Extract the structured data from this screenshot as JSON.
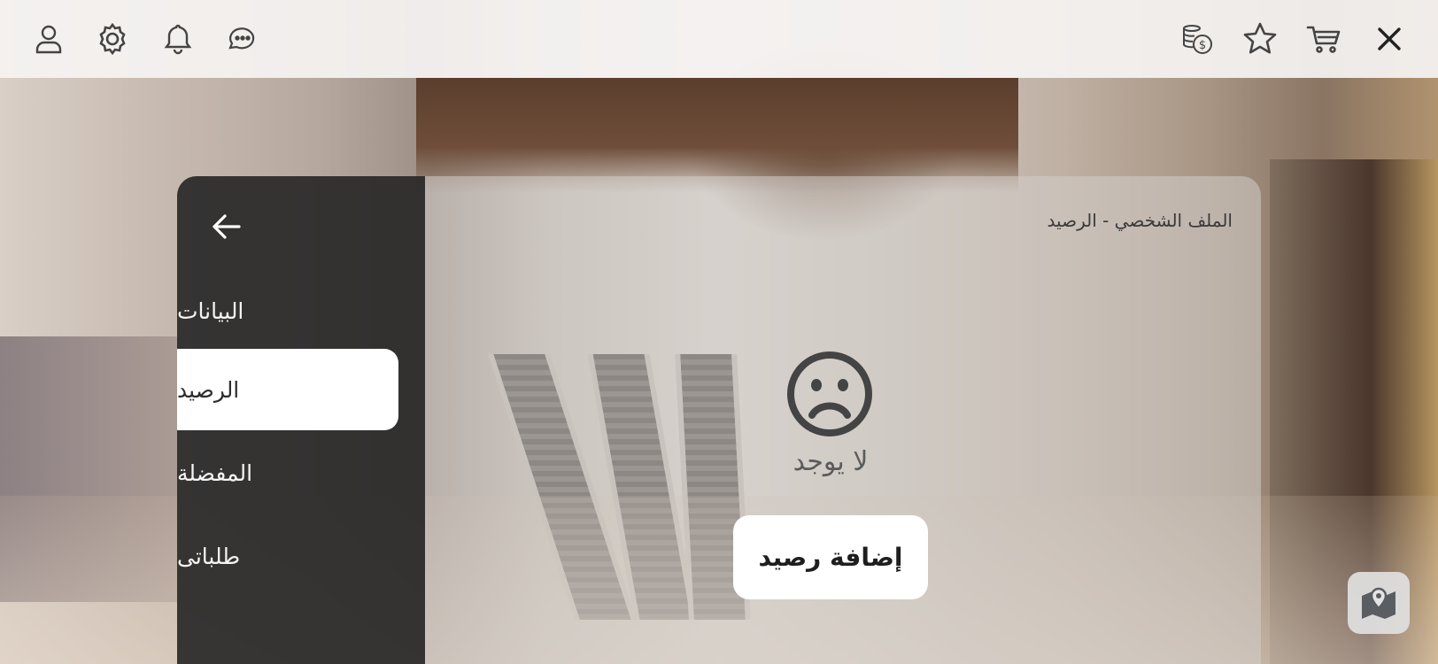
{
  "topbar": {
    "left_icons": [
      "user-icon",
      "settings-icon",
      "bell-icon",
      "chat-icon"
    ],
    "right_icons": [
      "coins-icon",
      "star-icon",
      "cart-icon",
      "close-icon"
    ]
  },
  "sidebar": {
    "back_icon": "arrow-left-icon",
    "items": [
      {
        "label": "البيانات",
        "active": false
      },
      {
        "label": "الرصيد",
        "active": true
      },
      {
        "label": "المفضلة",
        "active": false
      },
      {
        "label": "طلباتى",
        "active": false
      }
    ]
  },
  "content": {
    "breadcrumb": "الملف الشخصي - الرصيد",
    "empty_icon": "sad-face-icon",
    "empty_text": "لا يوجد",
    "add_button_label": "إضافة رصيد"
  },
  "floating": {
    "map_icon": "map-pin-icon"
  },
  "colors": {
    "sidebar_bg": "#282828",
    "active_item_bg": "#ffffff",
    "topbar_bg": "#f5f3f2",
    "icon_color": "#444444"
  }
}
